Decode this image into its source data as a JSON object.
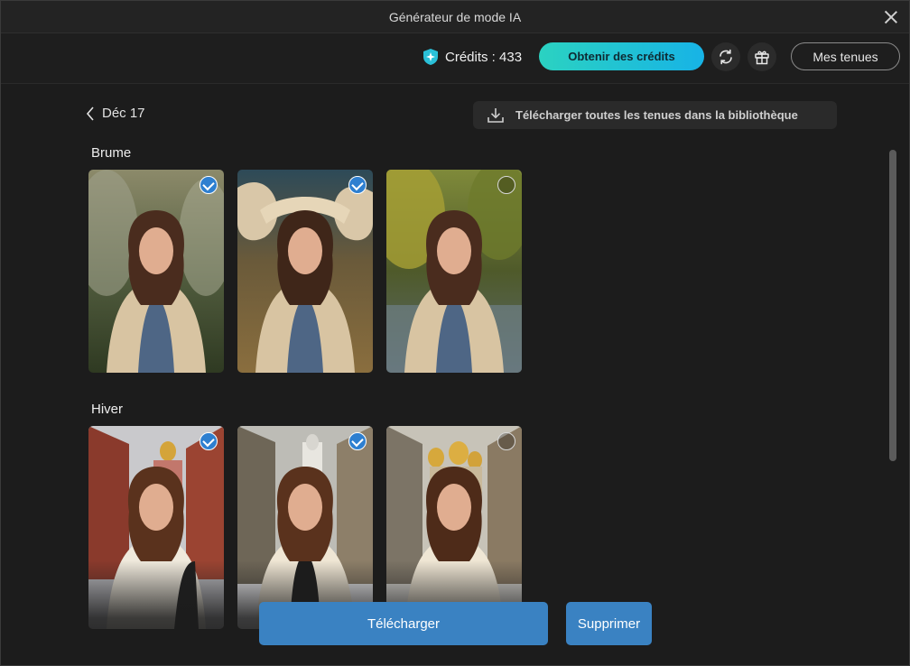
{
  "window": {
    "title": "Générateur de mode IA"
  },
  "toolbar": {
    "credits_label": "Crédits : 433",
    "get_credits_label": "Obtenir des crédits",
    "my_outfits_label": "Mes tenues",
    "accent_gradient": [
      "#2bd2c1",
      "#17b3e6"
    ]
  },
  "header": {
    "date": "Déc 17",
    "download_all_label": "Télécharger toutes les tenues dans la bibliothèque"
  },
  "sections": [
    {
      "title": "Brume",
      "images": [
        {
          "scene": "misty-forest-woman-cream-scarf",
          "selected": true
        },
        {
          "scene": "surreal-sculpture-field-woman",
          "selected": true
        },
        {
          "scene": "autumn-trees-meadow-woman",
          "selected": false
        }
      ]
    },
    {
      "title": "Hiver",
      "images": [
        {
          "scene": "red-brick-street-golden-domes",
          "selected": true
        },
        {
          "scene": "snowy-street-church-woman",
          "selected": true
        },
        {
          "scene": "golden-domes-alley-woman",
          "selected": false
        }
      ]
    }
  ],
  "footer": {
    "download_label": "Télécharger",
    "delete_label": "Supprimer",
    "button_color": "#3a82c2"
  }
}
